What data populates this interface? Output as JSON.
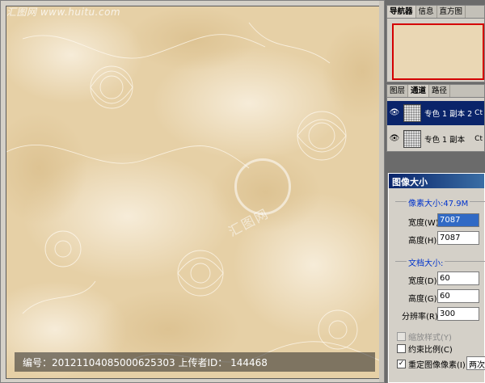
{
  "watermark": {
    "site": "汇图网 www.huitu.com",
    "center": "汇图网",
    "footer": "编号：20121104085000625303 上传者ID： 144468"
  },
  "navigator": {
    "tabs": [
      "导航器",
      "信息",
      "直方图"
    ]
  },
  "channels": {
    "tabs": [
      "图层",
      "通道",
      "路径"
    ],
    "items": [
      {
        "label": "专色 1 副本 2",
        "shortcut": "Ct",
        "selected": true
      },
      {
        "label": "专色 1 副本",
        "shortcut": "Ct",
        "selected": false
      }
    ]
  },
  "dialog": {
    "title": "图像大小",
    "pixel_size_label": "像素大小:47.9M",
    "width_label": "宽度(W):",
    "width_value": "7087",
    "height_label": "高度(H):",
    "height_value": "7087",
    "doc_size_label": "文档大小:",
    "doc_width_label": "宽度(D):",
    "doc_width_value": "60",
    "doc_height_label": "高度(G):",
    "doc_height_value": "60",
    "resolution_label": "分辨率(R):",
    "resolution_value": "300",
    "scale_styles_label": "缩放样式(Y)",
    "constrain_label": "约束比例(C)",
    "resample_label": "重定图像像素(I):",
    "resample_value": "两次立"
  },
  "colors": {
    "paper": "#ead7b4",
    "selection": "#0a246a",
    "title_bar": "#0a246a"
  }
}
